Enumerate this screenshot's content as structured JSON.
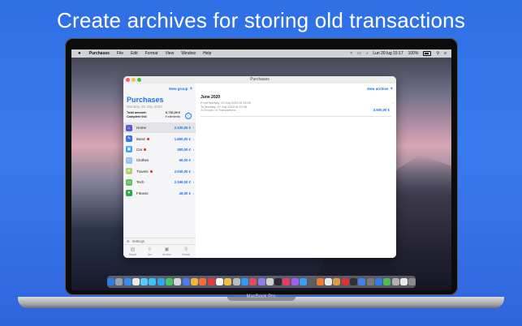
{
  "headline": "Create archives for storing old transactions",
  "device_label": "MacBook Pro",
  "menubar": {
    "app_name": "Purchases",
    "items": [
      "File",
      "Edit",
      "Format",
      "View",
      "Window",
      "Help"
    ],
    "datetime": "Lun 20 lug  15:17",
    "battery": "100%"
  },
  "window": {
    "title": "Purchases",
    "sidebar": {
      "new_group_label": "New group",
      "title": "Purchases",
      "subtitle": "Monday, 20 July 2020",
      "total_label": "Total amount:",
      "total_value": "6.710,00 €",
      "complete_label": "Complete list:",
      "complete_value": "9 elements",
      "groups": [
        {
          "name": "Home",
          "value": "2.100,00 €",
          "color": "#5b5bd6",
          "icon": "house-icon",
          "dot": false
        },
        {
          "name": "Band",
          "value": "1.890,00 €",
          "color": "#3576e8",
          "icon": "pencil-icon",
          "dot": true
        },
        {
          "name": "Car",
          "value": "380,00 €",
          "color": "#43a5f0",
          "icon": "car-icon",
          "dot": true
        },
        {
          "name": "Clothes",
          "value": "60,00 €",
          "color": "#8fc5f4",
          "icon": "shirt-icon",
          "dot": false
        },
        {
          "name": "Travels",
          "value": "2.040,00 €",
          "color": "#b2d46a",
          "icon": "plane-icon",
          "dot": true
        },
        {
          "name": "Tech",
          "value": "2.199,00 €",
          "color": "#5fc25a",
          "icon": "monitor-icon",
          "dot": false
        },
        {
          "name": "Fitness",
          "value": "49,00 €",
          "color": "#2fa84a",
          "icon": "heart-icon",
          "dot": false
        }
      ],
      "settings_label": "Settings",
      "tabs": [
        {
          "label": "Report",
          "icon": "report-icon"
        },
        {
          "label": "List",
          "icon": "list-icon"
        },
        {
          "label": "Archive",
          "icon": "archive-icon"
        },
        {
          "label": "Search",
          "icon": "search-icon"
        }
      ]
    },
    "detail": {
      "new_archive_label": "New archive",
      "archive": {
        "title": "June 2020",
        "from": "From Monday, 20 July 2020 At 15:08",
        "to": "To Monday, 20 July 2020 At 15:08",
        "summary": "3 Groups / 8 Transactions",
        "amount": "2.600,00 €"
      }
    }
  },
  "dock_colors": [
    "#2e7be8",
    "#9aa0a8",
    "#3a8cf3",
    "#e9e9e9",
    "#5ac8fa",
    "#37c4f5",
    "#2da5f0",
    "#48c468",
    "#d8d8d8",
    "#4b7cf0",
    "#f0b53a",
    "#f56b3a",
    "#e63a3a",
    "#f3f3f3",
    "#f0c040",
    "#bdbdbd",
    "#2f9cf4",
    "#e44a5a",
    "#8e7cf0",
    "#d0d0d0",
    "#2c2c2c",
    "#ec3b5a",
    "#a060f0",
    "#3aa0f5",
    "#5d5d5d",
    "#f07a30",
    "#e8e8e8",
    "#d6a040",
    "#e03030",
    "#303030",
    "#4080f0",
    "#7a7a7a",
    "#2f7de8",
    "#4abf58",
    "#b0b0b0",
    "#e8e8e8",
    "#8a8a8a"
  ]
}
